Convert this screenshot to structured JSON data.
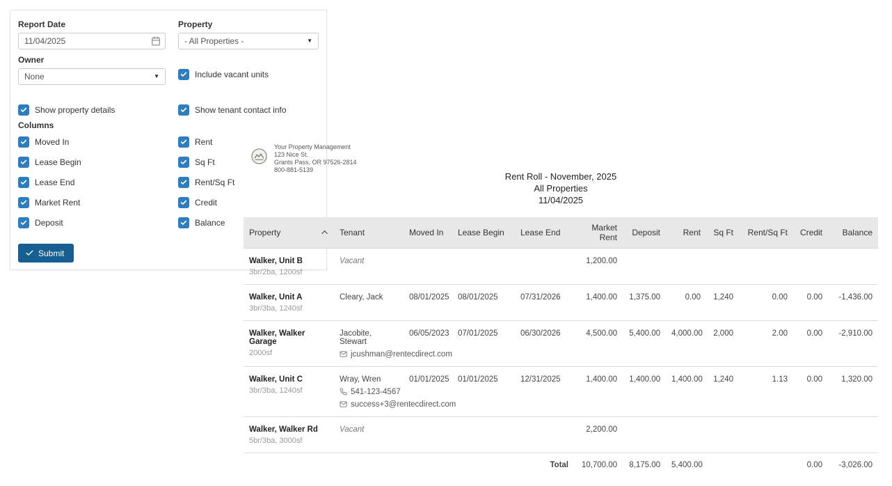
{
  "colors": {
    "checkbox_blue": "#2d7dbf",
    "submit_blue": "#175e92",
    "negative_red": "#cc1111",
    "table_header_bg": "#e8e8e8"
  },
  "icons": {
    "dropdown_arrow": "▼"
  },
  "form": {
    "report_date_label": "Report Date",
    "report_date_value": "11/04/2025",
    "property_label": "Property",
    "property_value": "- All Properties -",
    "owner_label": "Owner",
    "owner_value": "None",
    "include_vacant_label": "Include vacant units",
    "show_property_details_label": "Show property details",
    "show_tenant_contact_label": "Show tenant contact info",
    "columns_section_label": "Columns",
    "column_options_left": [
      "Moved In",
      "Lease Begin",
      "Lease End",
      "Market Rent",
      "Deposit"
    ],
    "column_options_right": [
      "Rent",
      "Sq Ft",
      "Rent/Sq Ft",
      "Credit",
      "Balance"
    ],
    "submit_label": "Submit"
  },
  "report": {
    "company": {
      "name": "Your Property Management",
      "address_line1": "123 Nice St.",
      "address_line2": "Grants Pass, OR 97526-2814",
      "phone": "800-881-5139"
    },
    "title": "Rent Roll - November, 2025",
    "subtitle": "All Properties",
    "report_date": "11/04/2025",
    "table": {
      "headers": [
        "Property",
        "Tenant",
        "Moved In",
        "Lease Begin",
        "Lease End",
        "Market Rent",
        "Deposit",
        "Rent",
        "Sq Ft",
        "Rent/Sq Ft",
        "Credit",
        "Balance"
      ],
      "rows": [
        {
          "property": "Walker, Unit B",
          "property_detail": "3br/2ba, 1200sf",
          "tenant": "Vacant",
          "moved_in": "",
          "lease_begin": "",
          "lease_end": "",
          "market_rent": "1,200.00",
          "deposit": "",
          "rent": "",
          "sq_ft": "",
          "rent_sq_ft": "",
          "credit": "",
          "balance": ""
        },
        {
          "property": "Walker, Unit A",
          "property_detail": "3br/3ba, 1240sf",
          "tenant": "Cleary, Jack",
          "moved_in": "08/01/2025",
          "lease_begin": "08/01/2025",
          "lease_end": "07/31/2026",
          "market_rent": "1,400.00",
          "deposit": "1,375.00",
          "rent": "0.00",
          "sq_ft": "1,240",
          "rent_sq_ft": "0.00",
          "credit": "0.00",
          "balance": "-1,436.00"
        },
        {
          "property": "Walker, Walker Garage",
          "property_detail": "2000sf",
          "tenant": "Jacobite, Stewart",
          "email": "jcushman@rentecdirect.com",
          "moved_in": "06/05/2023",
          "lease_begin": "07/01/2025",
          "lease_end": "06/30/2026",
          "market_rent": "4,500.00",
          "deposit": "5,400.00",
          "rent": "4,000.00",
          "sq_ft": "2,000",
          "rent_sq_ft": "2.00",
          "credit": "0.00",
          "balance": "-2,910.00"
        },
        {
          "property": "Walker, Unit C",
          "property_detail": "3br/3ba, 1240sf",
          "tenant": "Wray, Wren",
          "phone": "541-123-4567",
          "email": "success+3@rentecdirect.com",
          "moved_in": "01/01/2025",
          "lease_begin": "01/01/2025",
          "lease_end": "12/31/2025",
          "market_rent": "1,400.00",
          "deposit": "1,400.00",
          "rent": "1,400.00",
          "sq_ft": "1,240",
          "rent_sq_ft": "1.13",
          "credit": "0.00",
          "balance": "1,320.00"
        },
        {
          "property": "Walker, Walker Rd",
          "property_detail": "5br/3ba, 3000sf",
          "tenant": "Vacant",
          "moved_in": "",
          "lease_begin": "",
          "lease_end": "",
          "market_rent": "2,200.00",
          "deposit": "",
          "rent": "",
          "sq_ft": "",
          "rent_sq_ft": "",
          "credit": "",
          "balance": ""
        }
      ],
      "total": {
        "label": "Total",
        "market_rent": "10,700.00",
        "deposit": "8,175.00",
        "rent": "5,400.00",
        "credit": "0.00",
        "balance": "-3,026.00"
      }
    }
  }
}
